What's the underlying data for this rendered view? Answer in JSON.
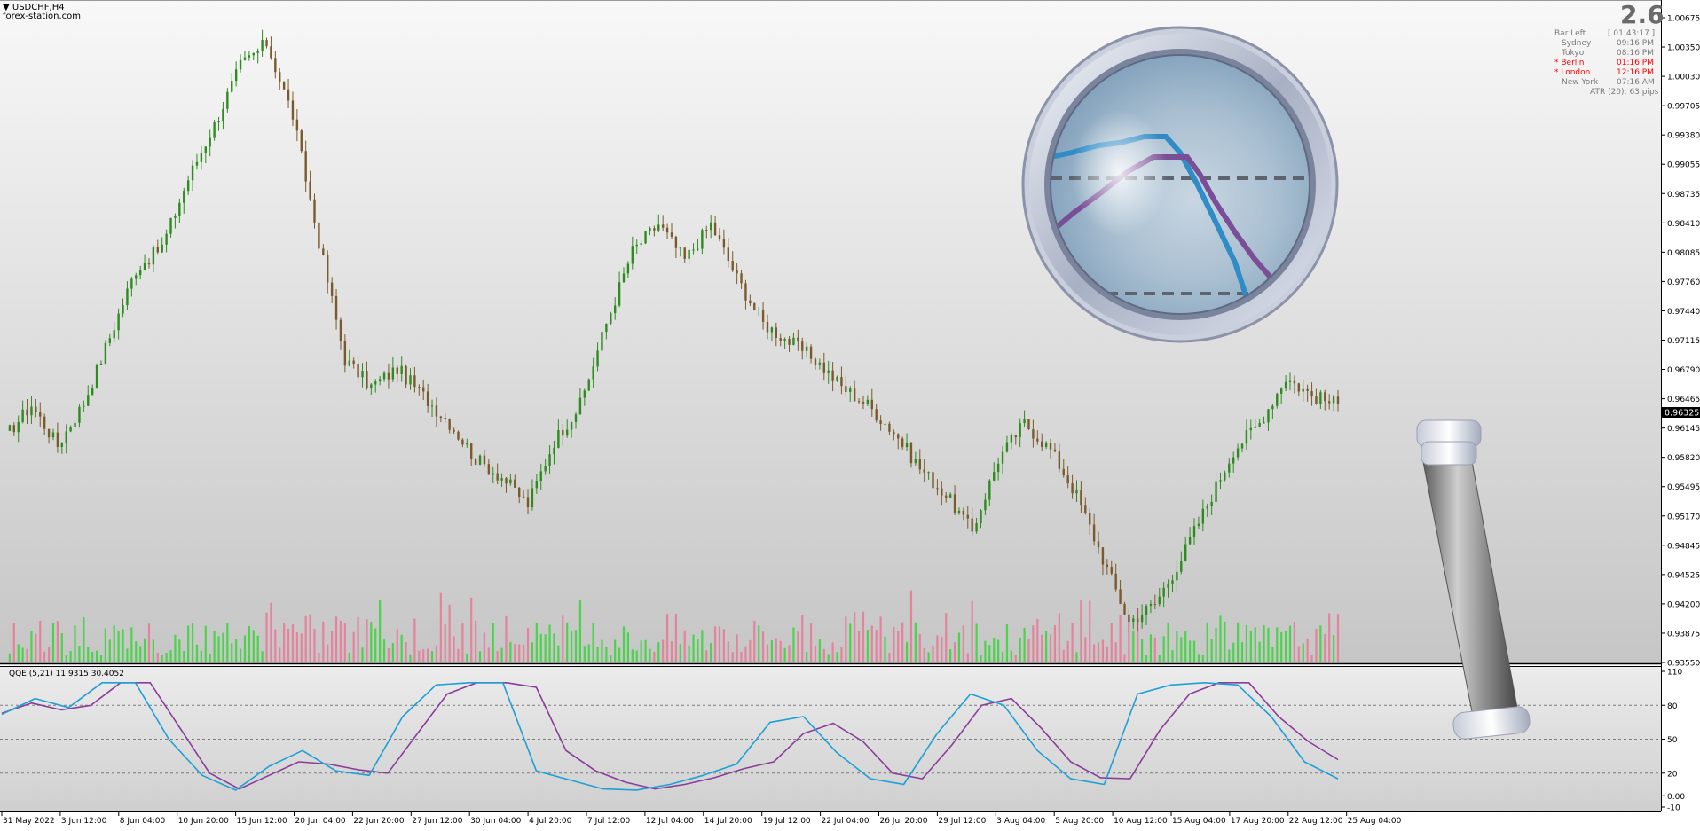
{
  "header": {
    "symbol_label": "USDCHF,H4",
    "watermark": "forex-station.com"
  },
  "info_panel": {
    "spread_value": "2.6",
    "bar_left_label": "Bar Left",
    "bar_left_value": "[ 01:43:17 ]",
    "sessions": [
      {
        "name": "Sydney",
        "time": "09:16 PM",
        "open": false
      },
      {
        "name": "Tokyo",
        "time": "08:16 PM",
        "open": false
      },
      {
        "name": "* Berlin",
        "time": "01:16 PM",
        "open": true
      },
      {
        "name": "* London",
        "time": "12:16 PM",
        "open": true
      },
      {
        "name": "New York",
        "time": "07:16 AM",
        "open": false
      }
    ],
    "atr_text": "ATR (20): 63 pips"
  },
  "price_axis": {
    "ticks": [
      "1.00675",
      "1.00350",
      "1.00030",
      "0.99705",
      "0.99380",
      "0.99055",
      "0.98735",
      "0.98410",
      "0.98085",
      "0.97760",
      "0.97440",
      "0.97115",
      "0.96790",
      "0.96465",
      "0.96145",
      "0.95820",
      "0.95495",
      "0.95170",
      "0.94845",
      "0.94525",
      "0.94200",
      "0.93875",
      "0.93550"
    ],
    "current_price": "0.96325"
  },
  "indicator": {
    "label": "QQE (5,21) 11.9315 30.4052",
    "levels": [
      "110",
      "80",
      "50",
      "20",
      "0.00",
      "-10"
    ]
  },
  "time_axis": {
    "ticks": [
      "31 May 2022",
      "3 Jun 12:00",
      "8 Jun 04:00",
      "10 Jun 20:00",
      "15 Jun 12:00",
      "20 Jun 04:00",
      "22 Jun 20:00",
      "27 Jun 12:00",
      "30 Jun 04:00",
      "4 Jul 20:00",
      "7 Jul 12:00",
      "12 Jul 04:00",
      "14 Jul 20:00",
      "19 Jul 12:00",
      "22 Jul 04:00",
      "26 Jul 20:00",
      "29 Jul 12:00",
      "3 Aug 04:00",
      "5 Aug 20:00",
      "10 Aug 12:00",
      "15 Aug 04:00",
      "17 Aug 20:00",
      "22 Aug 12:00",
      "25 Aug 04:00"
    ]
  },
  "colors": {
    "bull_candle": "#2e8b1f",
    "bear_candle": "#7a5a2a",
    "volume_up": "#3ed43e",
    "volume_down": "#e87b97",
    "qqe_fast": "#1ea0d6",
    "qqe_slow": "#8a3d9a",
    "session_open": "#ff0000",
    "session_closed": "#7a7a7a"
  },
  "chart_data": [
    {
      "type": "candlestick",
      "title": "USDCHF,H4",
      "ylim": [
        0.9355,
        1.0068
      ],
      "anchors_y": [
        0.9605,
        0.964,
        0.9595,
        0.9642,
        0.9715,
        0.979,
        0.9815,
        0.989,
        0.995,
        1.0015,
        1.004,
        0.996,
        0.982,
        0.969,
        0.966,
        0.968,
        0.965,
        0.962,
        0.958,
        0.956,
        0.953,
        0.96,
        0.964,
        0.973,
        0.981,
        0.984,
        0.98,
        0.984,
        0.978,
        0.973,
        0.971,
        0.969,
        0.966,
        0.964,
        0.961,
        0.957,
        0.954,
        0.95,
        0.958,
        0.962,
        0.959,
        0.954,
        0.947,
        0.94,
        0.942,
        0.947,
        0.953,
        0.959,
        0.962,
        0.967,
        0.965,
        0.964
      ],
      "volume_series": "tick volume (green up / pink down)"
    },
    {
      "type": "line",
      "title": "QQE (5,21) 11.9315 30.4052",
      "ylim": [
        -10,
        110
      ],
      "series": [
        {
          "values": [
            72,
            86,
            78,
            100,
            100,
            50,
            18,
            5,
            26,
            40,
            22,
            18,
            70,
            98,
            100,
            100,
            22,
            14,
            6,
            5,
            10,
            18,
            28,
            65,
            70,
            38,
            15,
            10,
            55,
            90,
            80,
            40,
            15,
            10,
            90,
            98,
            100,
            98,
            70,
            30,
            15
          ]
        },
        {
          "values": [
            73,
            82,
            76,
            80,
            100,
            100,
            60,
            20,
            6,
            18,
            30,
            28,
            23,
            20,
            55,
            90,
            100,
            100,
            96,
            40,
            22,
            12,
            6,
            10,
            16,
            24,
            30,
            55,
            64,
            48,
            20,
            15,
            45,
            80,
            86,
            60,
            30,
            16,
            15,
            58,
            90,
            100,
            100,
            70,
            48,
            32
          ]
        }
      ],
      "levels": [
        80,
        50,
        20
      ]
    }
  ]
}
